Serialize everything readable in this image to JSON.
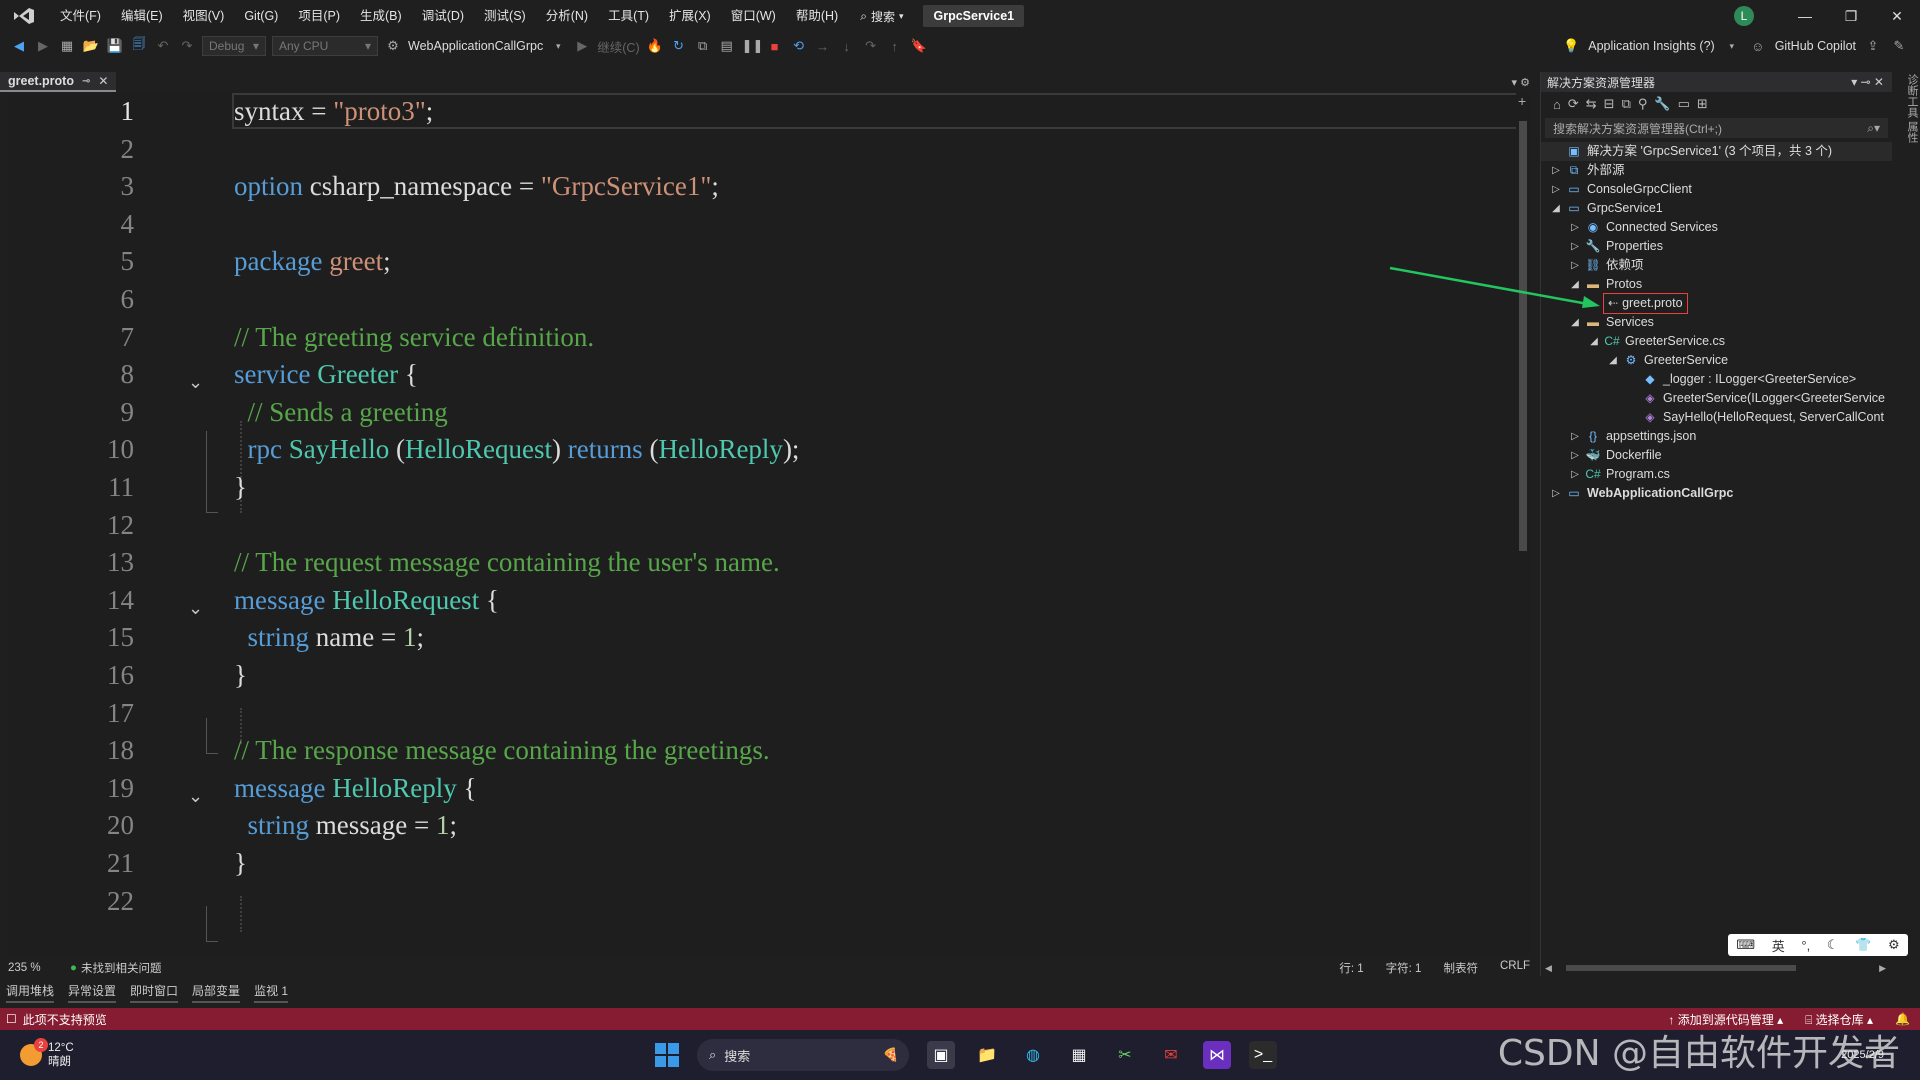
{
  "menu": [
    "文件(F)",
    "编辑(E)",
    "视图(V)",
    "Git(G)",
    "项目(P)",
    "生成(B)",
    "调试(D)",
    "测试(S)",
    "分析(N)",
    "工具(T)",
    "扩展(X)",
    "窗口(W)",
    "帮助(H)"
  ],
  "title_search": "搜索",
  "project_name": "GrpcService1",
  "avatar_letter": "L",
  "toolbar": {
    "config": "Debug",
    "platform": "Any CPU",
    "startup_project": "WebApplicationCallGrpc",
    "continue_label": "继续(C)",
    "insights": "Application Insights (?)",
    "copilot": "GitHub Copilot"
  },
  "editor": {
    "tab_name": "greet.proto",
    "zoom": "235 %",
    "issues": "未找到相关问题",
    "row": "行: 1",
    "col": "字符: 1",
    "indent": "制表符",
    "eol": "CRLF",
    "lines": [
      {
        "n": "1",
        "tokens": [
          [
            "pl",
            "syntax = "
          ],
          [
            "str",
            "\"proto3\""
          ],
          [
            "pl",
            ";"
          ]
        ]
      },
      {
        "n": "2",
        "tokens": []
      },
      {
        "n": "3",
        "tokens": [
          [
            "kw",
            "option"
          ],
          [
            "pl",
            " csharp_namespace = "
          ],
          [
            "str",
            "\"GrpcService1\""
          ],
          [
            "pl",
            ";"
          ]
        ]
      },
      {
        "n": "4",
        "tokens": []
      },
      {
        "n": "5",
        "tokens": [
          [
            "kw",
            "package"
          ],
          [
            "pl",
            " "
          ],
          [
            "str",
            "greet"
          ],
          [
            "pl",
            ";"
          ]
        ]
      },
      {
        "n": "6",
        "tokens": []
      },
      {
        "n": "7",
        "tokens": [
          [
            "cm",
            "// The greeting service definition."
          ]
        ]
      },
      {
        "n": "8",
        "tokens": [
          [
            "kw",
            "service"
          ],
          [
            "pl",
            " "
          ],
          [
            "ty",
            "Greeter"
          ],
          [
            "pl",
            " {"
          ]
        ]
      },
      {
        "n": "9",
        "tokens": [
          [
            "cm",
            "  // Sends a greeting"
          ]
        ]
      },
      {
        "n": "10",
        "tokens": [
          [
            "pl",
            "  "
          ],
          [
            "kw",
            "rpc"
          ],
          [
            "pl",
            " "
          ],
          [
            "ty",
            "SayHello"
          ],
          [
            "pl",
            " ("
          ],
          [
            "ty",
            "HelloRequest"
          ],
          [
            "pl",
            ") "
          ],
          [
            "kw",
            "returns"
          ],
          [
            "pl",
            " ("
          ],
          [
            "ty",
            "HelloReply"
          ],
          [
            "pl",
            ");"
          ]
        ]
      },
      {
        "n": "11",
        "tokens": [
          [
            "pl",
            "}"
          ]
        ]
      },
      {
        "n": "12",
        "tokens": []
      },
      {
        "n": "13",
        "tokens": [
          [
            "cm",
            "// The request message containing the user's name."
          ]
        ]
      },
      {
        "n": "14",
        "tokens": [
          [
            "kw",
            "message"
          ],
          [
            "pl",
            " "
          ],
          [
            "ty",
            "HelloRequest"
          ],
          [
            "pl",
            " {"
          ]
        ]
      },
      {
        "n": "15",
        "tokens": [
          [
            "pl",
            "  "
          ],
          [
            "kw",
            "string"
          ],
          [
            "pl",
            " name = "
          ],
          [
            "num",
            "1"
          ],
          [
            "pl",
            ";"
          ]
        ]
      },
      {
        "n": "16",
        "tokens": [
          [
            "pl",
            "}"
          ]
        ]
      },
      {
        "n": "17",
        "tokens": []
      },
      {
        "n": "18",
        "tokens": [
          [
            "cm",
            "// The response message containing the greetings."
          ]
        ]
      },
      {
        "n": "19",
        "tokens": [
          [
            "kw",
            "message"
          ],
          [
            "pl",
            " "
          ],
          [
            "ty",
            "HelloReply"
          ],
          [
            "pl",
            " {"
          ]
        ]
      },
      {
        "n": "20",
        "tokens": [
          [
            "pl",
            "  "
          ],
          [
            "kw",
            "string"
          ],
          [
            "pl",
            " message = "
          ],
          [
            "num",
            "1"
          ],
          [
            "pl",
            ";"
          ]
        ]
      },
      {
        "n": "21",
        "tokens": [
          [
            "pl",
            "}"
          ]
        ]
      },
      {
        "n": "22",
        "tokens": []
      }
    ],
    "fold_lines": [
      "8",
      "14",
      "19"
    ]
  },
  "bottom_tabs": [
    "调用堆栈",
    "异常设置",
    "即时窗口",
    "局部变量",
    "监视 1"
  ],
  "solution_explorer": {
    "title": "解决方案资源管理器",
    "search_placeholder": "搜索解决方案资源管理器(Ctrl+;)",
    "items": [
      {
        "depth": 0,
        "arrow": "",
        "icon": "solution-icon",
        "glyph": "▣",
        "label": "解决方案 'GrpcService1' (3 个项目，共 3 个)",
        "bold": false
      },
      {
        "depth": 0,
        "arrow": "▷",
        "icon": "external-sources-icon",
        "glyph": "⧉",
        "label": "外部源",
        "bold": false
      },
      {
        "depth": 0,
        "arrow": "▷",
        "icon": "project-icon",
        "glyph": "▭",
        "label": "ConsoleGrpcClient",
        "bold": false
      },
      {
        "depth": 0,
        "arrow": "◢",
        "icon": "project-icon",
        "glyph": "▭",
        "label": "GrpcService1",
        "bold": false
      },
      {
        "depth": 1,
        "arrow": "▷",
        "icon": "connected-services-icon",
        "glyph": "◉",
        "label": "Connected Services",
        "bold": false
      },
      {
        "depth": 1,
        "arrow": "▷",
        "icon": "properties-icon",
        "glyph": "🔧",
        "label": "Properties",
        "bold": false
      },
      {
        "depth": 1,
        "arrow": "▷",
        "icon": "dependencies-icon",
        "glyph": "⛓",
        "label": "依赖项",
        "bold": false
      },
      {
        "depth": 1,
        "arrow": "◢",
        "icon": "folder-icon",
        "glyph": "▬",
        "label": "Protos",
        "bold": false
      },
      {
        "depth": 2,
        "arrow": "",
        "icon": "proto-file-icon",
        "glyph": "⇠",
        "label": "greet.proto",
        "bold": false,
        "selected": true
      },
      {
        "depth": 1,
        "arrow": "◢",
        "icon": "folder-icon",
        "glyph": "▬",
        "label": "Services",
        "bold": false
      },
      {
        "depth": 2,
        "arrow": "◢",
        "icon": "csharp-file-icon",
        "glyph": "C#",
        "label": "GreeterService.cs",
        "bold": false
      },
      {
        "depth": 3,
        "arrow": "◢",
        "icon": "class-icon",
        "glyph": "⚙",
        "label": "GreeterService",
        "bold": false
      },
      {
        "depth": 4,
        "arrow": "",
        "icon": "field-icon",
        "glyph": "◆",
        "label": "_logger : ILogger<GreeterService>",
        "bold": false
      },
      {
        "depth": 4,
        "arrow": "",
        "icon": "method-icon",
        "glyph": "◈",
        "label": "GreeterService(ILogger<GreeterService",
        "bold": false
      },
      {
        "depth": 4,
        "arrow": "",
        "icon": "method-icon",
        "glyph": "◈",
        "label": "SayHello(HelloRequest, ServerCallCont",
        "bold": false
      },
      {
        "depth": 1,
        "arrow": "▷",
        "icon": "json-file-icon",
        "glyph": "{}",
        "label": "appsettings.json",
        "bold": false
      },
      {
        "depth": 1,
        "arrow": "▷",
        "icon": "docker-icon",
        "glyph": "🐳",
        "label": "Dockerfile",
        "bold": false
      },
      {
        "depth": 1,
        "arrow": "▷",
        "icon": "csharp-file-icon",
        "glyph": "C#",
        "label": "Program.cs",
        "bold": false
      },
      {
        "depth": 0,
        "arrow": "▷",
        "icon": "project-icon",
        "glyph": "▭",
        "label": "WebApplicationCallGrpc",
        "bold": true
      }
    ]
  },
  "statusbar": {
    "left": "此项不支持预览",
    "add_source": "添加到源代码管理",
    "select_repo": "选择仓库",
    "color": "#861c31"
  },
  "taskbar": {
    "temperature": "12°C",
    "weather": "晴朗",
    "weather_badge": "2",
    "search": "搜索",
    "date": "2025/2/9"
  },
  "watermark": "CSDN @自由软件开发者",
  "ime": [
    "英"
  ]
}
